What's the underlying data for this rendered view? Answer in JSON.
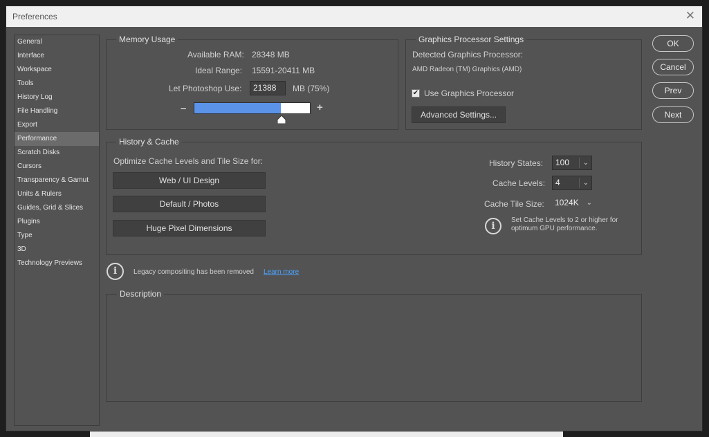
{
  "window": {
    "title": "Preferences",
    "close_glyph": "✕"
  },
  "sidebar": {
    "items": [
      {
        "label": "General"
      },
      {
        "label": "Interface"
      },
      {
        "label": "Workspace"
      },
      {
        "label": "Tools"
      },
      {
        "label": "History Log"
      },
      {
        "label": "File Handling"
      },
      {
        "label": "Export"
      },
      {
        "label": "Performance",
        "selected": true
      },
      {
        "label": "Scratch Disks"
      },
      {
        "label": "Cursors"
      },
      {
        "label": "Transparency & Gamut"
      },
      {
        "label": "Units & Rulers"
      },
      {
        "label": "Guides, Grid & Slices"
      },
      {
        "label": "Plugins"
      },
      {
        "label": "Type"
      },
      {
        "label": "3D"
      },
      {
        "label": "Technology Previews"
      }
    ]
  },
  "memory": {
    "legend": "Memory Usage",
    "available_label": "Available RAM:",
    "available_value": "28348 MB",
    "ideal_label": "Ideal Range:",
    "ideal_value": "15591-20411 MB",
    "let_label": "Let Photoshop Use:",
    "let_value": "21388",
    "let_unit": "MB (75%)",
    "minus": "–",
    "plus": "+",
    "slider_fraction": 0.75,
    "slider_color": "#5b93e8"
  },
  "gpu": {
    "legend": "Graphics Processor Settings",
    "detected_label": "Detected Graphics Processor:",
    "detected_value": "AMD Radeon (TM) Graphics (AMD)",
    "use_label": "Use Graphics Processor",
    "use_checked": true,
    "check_glyph": "✔",
    "advanced_button": "Advanced Settings..."
  },
  "history_cache": {
    "legend": "History & Cache",
    "optimize_label": "Optimize Cache Levels and Tile Size for:",
    "buttons": [
      "Web / UI Design",
      "Default / Photos",
      "Huge Pixel Dimensions"
    ],
    "history_states_label": "History States:",
    "history_states_value": "100",
    "cache_levels_label": "Cache Levels:",
    "cache_levels_value": "4",
    "cache_tile_label": "Cache Tile Size:",
    "cache_tile_value": "1024K",
    "chevron_glyph": "⌄",
    "info_text_1": "Set Cache Levels to 2 or higher for",
    "info_text_2": "optimum GPU performance."
  },
  "legacy": {
    "text": "Legacy compositing has been removed",
    "link": "Learn more",
    "icon_glyph": "i"
  },
  "description": {
    "legend": "Description"
  },
  "actions": {
    "ok": "OK",
    "cancel": "Cancel",
    "prev": "Prev",
    "next": "Next"
  }
}
